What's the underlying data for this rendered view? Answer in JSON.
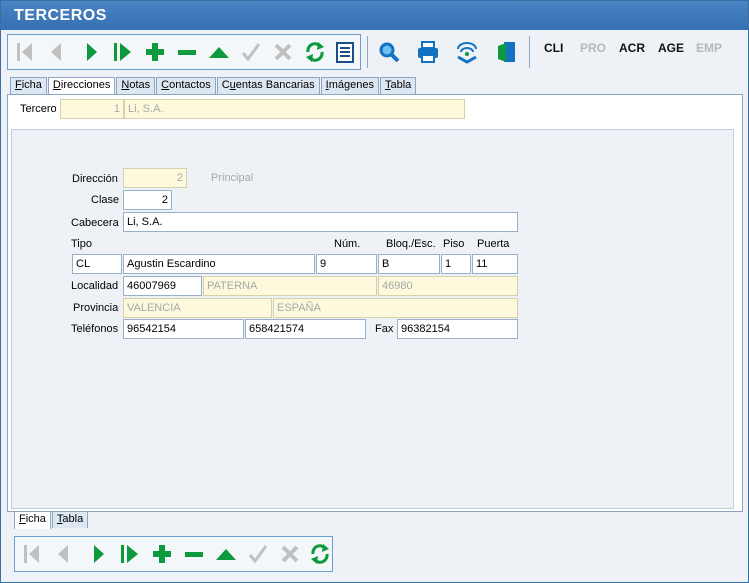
{
  "window": {
    "title": "TERCEROS"
  },
  "toolbar": {
    "text_buttons": [
      "CLI",
      "PRO",
      "ACR",
      "AGE",
      "EMP"
    ],
    "text_button_states": [
      true,
      false,
      true,
      true,
      false
    ]
  },
  "top_tabs": [
    {
      "pre": "",
      "key": "F",
      "post": "icha",
      "active": false
    },
    {
      "pre": "",
      "key": "D",
      "post": "irecciones",
      "active": true
    },
    {
      "pre": "",
      "key": "N",
      "post": "otas",
      "active": false
    },
    {
      "pre": "",
      "key": "C",
      "post": "ontactos",
      "active": false
    },
    {
      "pre": "C",
      "key": "u",
      "post": "entas Bancarias",
      "active": false
    },
    {
      "pre": "",
      "key": "I",
      "post": "mágenes",
      "active": false
    },
    {
      "pre": "",
      "key": "T",
      "post": "abla",
      "active": false
    }
  ],
  "tercero": {
    "label": "Tercero",
    "id": "1",
    "name": "Li, S.A."
  },
  "form": {
    "direccion_label": "Dirección",
    "direccion_value": "2",
    "principal_label": "Principal",
    "clase_label": "Clase",
    "clase_value": "2",
    "cabecera_label": "Cabecera",
    "cabecera_value": "Li, S.A.",
    "tipo_label": "Tipo",
    "num_label": "Núm.",
    "bloq_label": "Bloq./Esc.",
    "piso_label": "Piso",
    "puerta_label": "Puerta",
    "tipo_value": "CL",
    "calle_value": "Agustin Escardino",
    "num_value": "9",
    "bloq_value": "B",
    "piso_value": "1",
    "puerta_value": "11",
    "localidad_label": "Localidad",
    "localidad_code": "46007969",
    "localidad_name": "PATERNA",
    "cp_value": "46980",
    "provincia_label": "Provincia",
    "provincia_value": "VALENCIA",
    "pais_value": "ESPAÑA",
    "telefonos_label": "Teléfonos",
    "telefono1": "96542154",
    "telefono2": "658421574",
    "fax_label": "Fax",
    "fax_value": "96382154"
  },
  "bottom_tabs": [
    {
      "pre": "",
      "key": "F",
      "post": "icha",
      "active": true
    },
    {
      "pre": "",
      "key": "T",
      "post": "abla",
      "active": false
    }
  ],
  "colors": {
    "title_bar": "#3a75b8",
    "nav_green": "#0c9a3c",
    "disabled_gray": "#b8b8b8",
    "tool_blue": "#1273c4"
  }
}
